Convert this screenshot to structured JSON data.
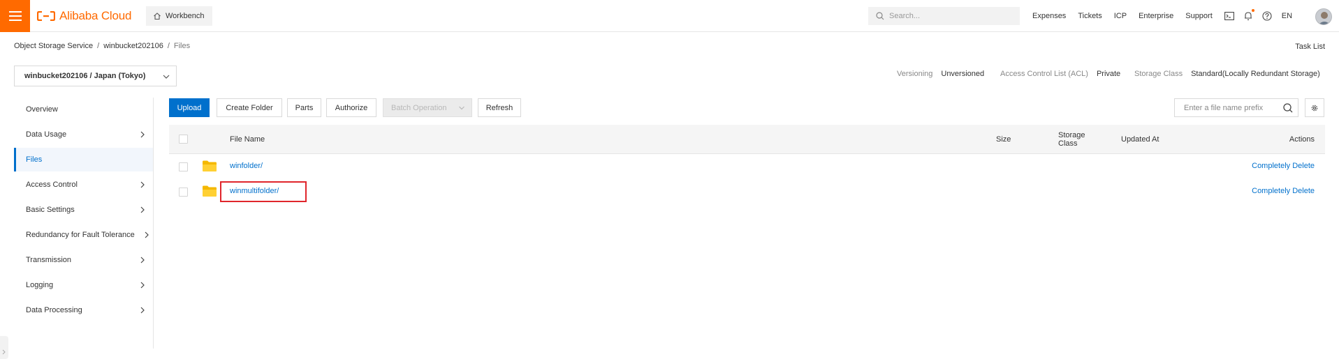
{
  "topbar": {
    "brand": "Alibaba Cloud",
    "workbench": "Workbench",
    "search_placeholder": "Search...",
    "nav": [
      "Expenses",
      "Tickets",
      "ICP",
      "Enterprise",
      "Support"
    ],
    "language": "EN",
    "brand_color": "#ff6a00"
  },
  "breadcrumb": {
    "items": [
      "Object Storage Service",
      "winbucket202106",
      "Files"
    ],
    "separator": "/"
  },
  "task_list": "Task List",
  "bucket": {
    "selected": "winbucket202106 / Japan (Tokyo)"
  },
  "meta": {
    "versioning_label": "Versioning",
    "versioning_value": "Unversioned",
    "acl_label": "Access Control List (ACL)",
    "acl_value": "Private",
    "storage_label": "Storage Class",
    "storage_value": "Standard(Locally Redundant Storage)"
  },
  "sidebar": {
    "items": [
      {
        "label": "Overview"
      },
      {
        "label": "Data Usage"
      },
      {
        "label": "Files"
      },
      {
        "label": "Access Control"
      },
      {
        "label": "Basic Settings"
      },
      {
        "label": "Redundancy for Fault Tolerance"
      },
      {
        "label": "Transmission"
      },
      {
        "label": "Logging"
      },
      {
        "label": "Data Processing"
      }
    ],
    "active": "Files"
  },
  "toolbar": {
    "upload": "Upload",
    "create_folder": "Create Folder",
    "parts": "Parts",
    "authorize": "Authorize",
    "batch_operation": "Batch Operation",
    "refresh": "Refresh",
    "prefix_placeholder": "Enter a file name prefix"
  },
  "table": {
    "headers": {
      "file_name": "File Name",
      "size": "Size",
      "storage_class_line1": "Storage",
      "storage_class_line2": "Class",
      "updated_at": "Updated At",
      "actions": "Actions"
    },
    "rows": [
      {
        "name": "winfolder/",
        "action": "Completely Delete"
      },
      {
        "name": "winmultifolder/",
        "action": "Completely Delete"
      }
    ]
  },
  "colors": {
    "accent": "#0070cc",
    "highlight": "#e0252b",
    "folder": "#ffc400"
  }
}
